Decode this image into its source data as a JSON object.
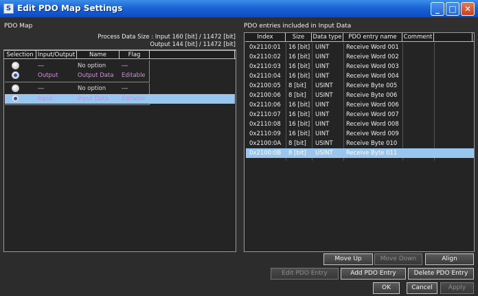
{
  "window": {
    "title": "Edit PDO Map Settings",
    "icon_letter": "S",
    "minimize_glyph": "_",
    "maximize_glyph": "□",
    "close_glyph": "✕"
  },
  "pdo_map": {
    "title": "PDO Map",
    "process_size_line1": "Process Data Size : Input  160 [bit]  /  11472 [bit]",
    "process_size_line2": "Output  144 [bit]  /  11472 [bit]",
    "columns": [
      "Selection",
      "Input/Output",
      "Name",
      "Flag"
    ],
    "groups": [
      {
        "rows": [
          {
            "selected": false,
            "io": "---",
            "name": "No option",
            "flag": "---"
          },
          {
            "selected": true,
            "io": "Output",
            "name": "Output Data",
            "flag": "Editable"
          }
        ]
      },
      {
        "rows": [
          {
            "selected": false,
            "io": "---",
            "name": "No option",
            "flag": "---"
          },
          {
            "selected": true,
            "io": "Input",
            "name": "Input Data",
            "flag": "Editable"
          }
        ]
      }
    ]
  },
  "entries": {
    "title": "PDO entries included in Input Data",
    "columns": [
      "Index",
      "Size",
      "Data type",
      "PDO entry name",
      "Comment"
    ],
    "rows": [
      {
        "index": "0x2110:01",
        "size": "16 [bit]",
        "type": "UINT",
        "name": "Receive Word 001"
      },
      {
        "index": "0x2110:02",
        "size": "16 [bit]",
        "type": "UINT",
        "name": "Receive Word 002"
      },
      {
        "index": "0x2110:03",
        "size": "16 [bit]",
        "type": "UINT",
        "name": "Receive Word 003"
      },
      {
        "index": "0x2110:04",
        "size": "16 [bit]",
        "type": "UINT",
        "name": "Receive Word 004"
      },
      {
        "index": "0x2100:05",
        "size": "8 [bit]",
        "type": "USINT",
        "name": "Receive Byte 005"
      },
      {
        "index": "0x2100:06",
        "size": "8 [bit]",
        "type": "USINT",
        "name": "Receive Byte 006"
      },
      {
        "index": "0x2110:06",
        "size": "16 [bit]",
        "type": "UINT",
        "name": "Receive Word 006"
      },
      {
        "index": "0x2110:07",
        "size": "16 [bit]",
        "type": "UINT",
        "name": "Receive Word 007"
      },
      {
        "index": "0x2110:08",
        "size": "16 [bit]",
        "type": "UINT",
        "name": "Receive Word 008"
      },
      {
        "index": "0x2110:09",
        "size": "16 [bit]",
        "type": "UINT",
        "name": "Receive Word 009"
      },
      {
        "index": "0x2100:0A",
        "size": "8 [bit]",
        "type": "USINT",
        "name": "Receive Byte 010"
      },
      {
        "index": "0x2100:0B",
        "size": "8 [bit]",
        "type": "USINT",
        "name": "Receive Byte 011"
      }
    ]
  },
  "buttons": {
    "move_up": "Move Up",
    "move_down": "Move Down",
    "align": "Align",
    "edit_entry": "Edit PDO Entry",
    "add_entry": "Add PDO Entry",
    "delete_entry": "Delete PDO Entry",
    "ok": "OK",
    "cancel": "Cancel",
    "apply": "Apply"
  },
  "colors": {
    "selection_highlight": "#99c6ee",
    "pink_text": "#d58be3"
  }
}
